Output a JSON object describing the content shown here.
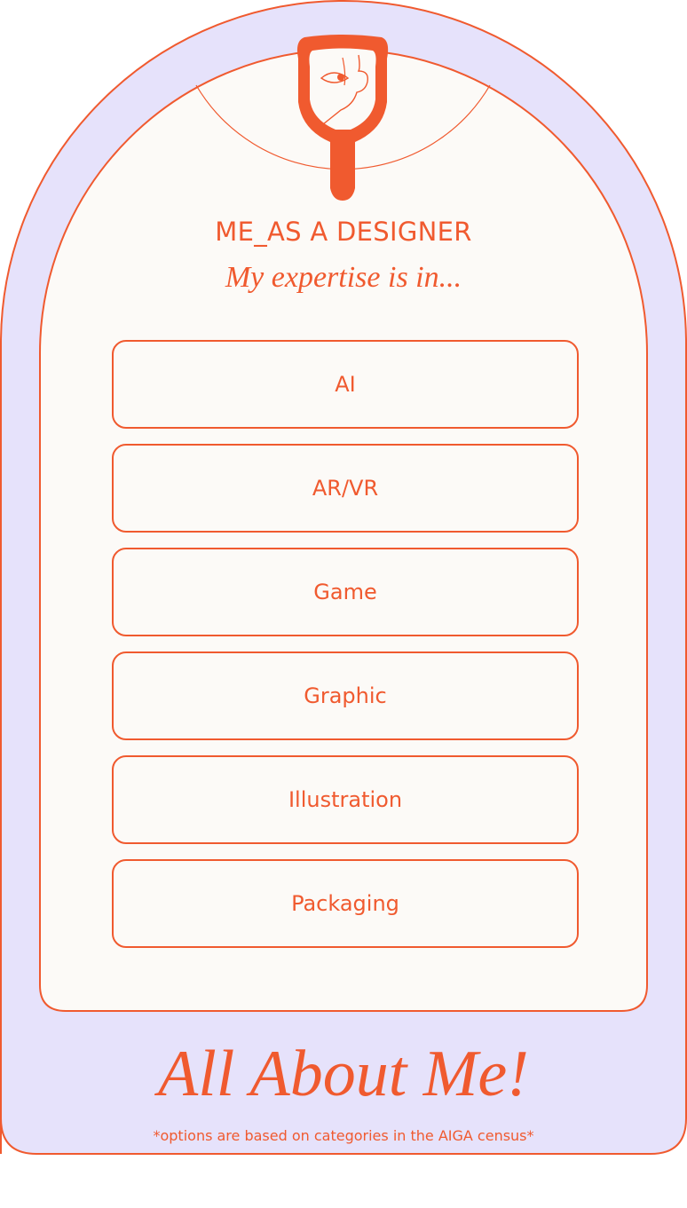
{
  "card": {
    "heading": "ME_AS A DESIGNER",
    "subheading": "My expertise is in...",
    "icon": "hand-mirror-icon"
  },
  "options": [
    {
      "label": "AI"
    },
    {
      "label": "AR/VR"
    },
    {
      "label": "Game"
    },
    {
      "label": "Graphic"
    },
    {
      "label": "Illustration"
    },
    {
      "label": "Packaging"
    }
  ],
  "footer": {
    "title": "All About Me!",
    "note": "*options are based on categories in the AIGA census*"
  },
  "colors": {
    "accent": "#f05a2f",
    "outer_fill": "#e6e2fb",
    "card_fill": "#fcfaf7"
  }
}
